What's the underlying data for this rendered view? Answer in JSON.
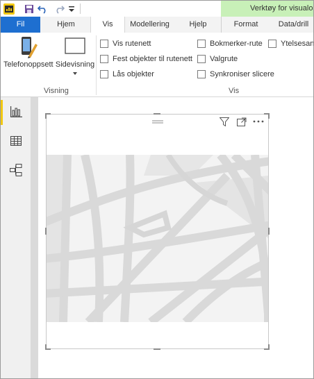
{
  "titlebar": {
    "save_icon": "save-icon",
    "undo_icon": "undo-icon",
    "redo_icon": "redo-icon",
    "customize_icon": "customize-quick-access-icon",
    "context_group": "Verktøy for visualob"
  },
  "tabs": [
    {
      "label": "Fil"
    },
    {
      "label": "Hjem"
    },
    {
      "label": "Vis"
    },
    {
      "label": "Modellering"
    },
    {
      "label": "Hjelp"
    },
    {
      "label": "Format"
    },
    {
      "label": "Data/drill"
    }
  ],
  "ribbon": {
    "visning": {
      "group_label": "Visning",
      "phone_layout": "Telefonoppsett",
      "page_view": "Sidevisning"
    },
    "vis": {
      "group_label": "Vis",
      "checkboxes": [
        {
          "label": "Vis rutenett",
          "checked": false
        },
        {
          "label": "Fest objekter til rutenett",
          "checked": false
        },
        {
          "label": "Lås objekter",
          "checked": false
        },
        {
          "label": "Bokmerker-rute",
          "checked": false
        },
        {
          "label": "Valgrute",
          "checked": false
        },
        {
          "label": "Synkroniser slicere",
          "checked": false
        },
        {
          "label": "Ytelsesana",
          "checked": false
        }
      ]
    }
  },
  "rail": [
    {
      "name": "report-view",
      "icon": "bar-chart-icon",
      "active": true
    },
    {
      "name": "data-view",
      "icon": "table-icon",
      "active": false
    },
    {
      "name": "model-view",
      "icon": "model-icon",
      "active": false
    }
  ],
  "visual_header": {
    "icons": [
      "filter-icon",
      "focus-mode-icon",
      "more-options-icon"
    ]
  },
  "colors": {
    "file_tab": "#1e6fd0",
    "context_header": "#c8f0b8",
    "active_rail": "#f2c811"
  }
}
